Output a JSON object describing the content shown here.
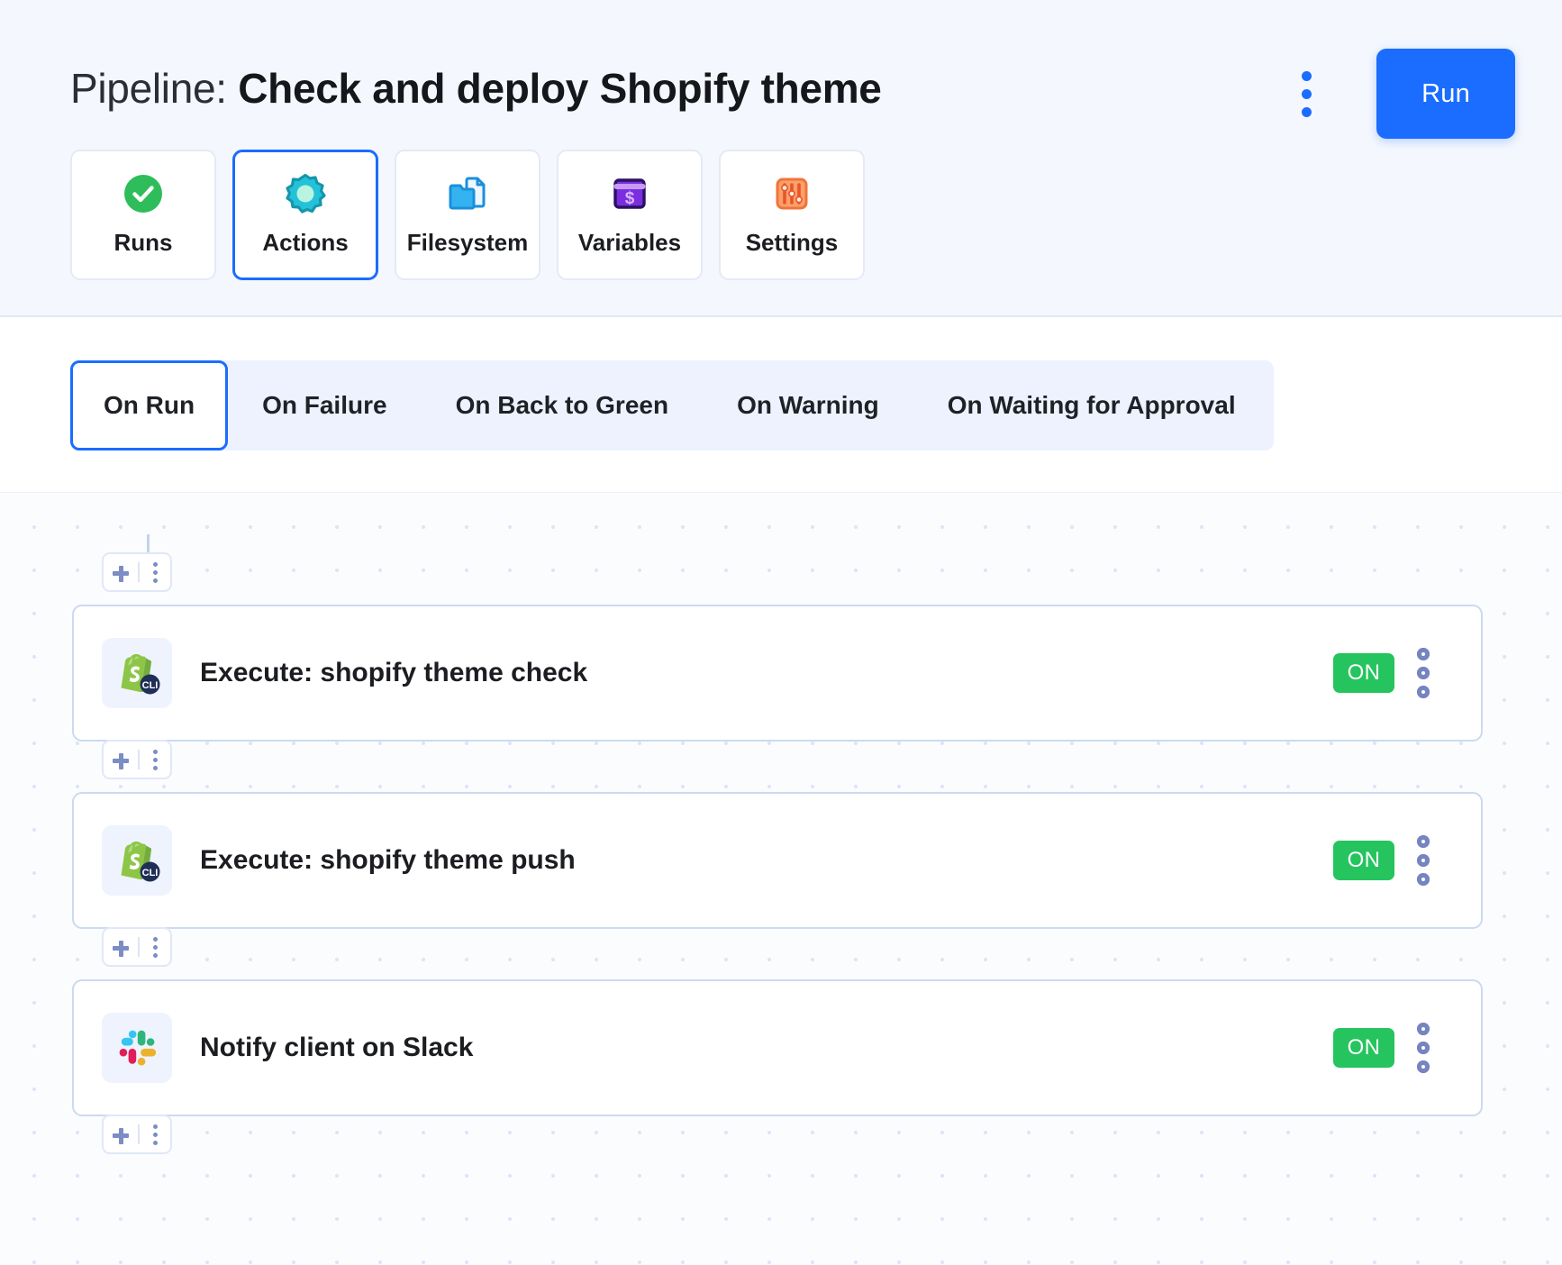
{
  "header": {
    "title_prefix": "Pipeline: ",
    "title_name": "Check and deploy Shopify theme",
    "kebab_icon": "kebab-menu-icon",
    "run_label": "Run",
    "nav": [
      {
        "label": "Runs",
        "icon": "check-circle-icon",
        "active": false
      },
      {
        "label": "Actions",
        "icon": "gear-icon",
        "active": true
      },
      {
        "label": "Filesystem",
        "icon": "folder-file-icon",
        "active": false
      },
      {
        "label": "Variables",
        "icon": "dollar-window-icon",
        "active": false
      },
      {
        "label": "Settings",
        "icon": "sliders-icon",
        "active": false
      }
    ]
  },
  "triggers": {
    "tabs": [
      {
        "label": "On Run",
        "active": true
      },
      {
        "label": "On Failure",
        "active": false
      },
      {
        "label": "On Back to Green",
        "active": false
      },
      {
        "label": "On Warning",
        "active": false
      },
      {
        "label": "On Waiting for Approval",
        "active": false
      }
    ]
  },
  "canvas": {
    "add_pill": {
      "plus_icon": "plus-icon",
      "kebab_icon": "kebab-menu-icon"
    },
    "actions": [
      {
        "label": "Execute: shopify theme check",
        "icon": "shopify-cli-icon",
        "toggle": "ON"
      },
      {
        "label": "Execute: shopify theme push",
        "icon": "shopify-cli-icon",
        "toggle": "ON"
      },
      {
        "label": "Notify client on Slack",
        "icon": "slack-icon",
        "toggle": "ON"
      }
    ]
  },
  "colors": {
    "accent_blue": "#1a6dff",
    "toggle_green": "#25c45e",
    "header_bg": "#f4f7fd",
    "tabbar_bg": "#edf2fe",
    "card_border": "#ccdaf0",
    "canvas_dot": "#dde5f7"
  }
}
